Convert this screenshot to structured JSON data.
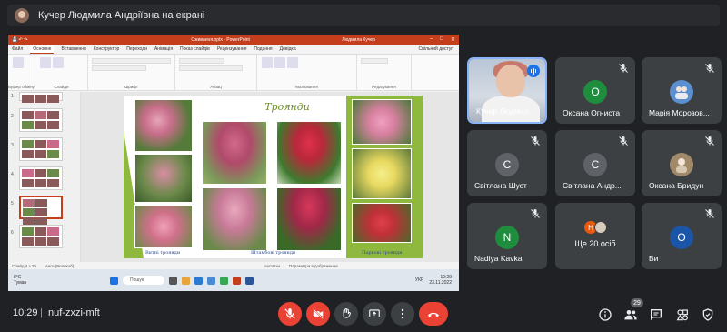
{
  "banner": {
    "text": "Кучер Людмила Андріївна на екрані"
  },
  "presentation": {
    "app_title": "Оживання.pptx  -  PowerPoint",
    "user_name": "Людмила Кучер",
    "tabs": [
      "Файл",
      "Основне",
      "Вставлення",
      "Конструктор",
      "Переходи",
      "Анімація",
      "Показ слайдів",
      "Рецензування",
      "Подання",
      "Довідка"
    ],
    "active_tab": "Основне",
    "share_label": "Спільний доступ",
    "ribbon_groups": [
      "Буфер обміну",
      "Слайди",
      "Шрифт",
      "Абзац",
      "Малювання",
      "Редагування"
    ],
    "slide_numbers": [
      "1",
      "2",
      "3",
      "4",
      "5",
      "6"
    ],
    "slide_title": "Троянди",
    "captions": [
      "Витні троянди",
      "Штамбові троянди",
      "Паркові троянди"
    ],
    "status_left": "Слайд 4 з 29",
    "status_lang": "Англ (Великоб)",
    "status_notes": "Нотатки",
    "status_display": "Параметри відображення",
    "weather_temp": "8°C",
    "weather_desc": "Туман",
    "taskbar_search": "Пошук",
    "tray_lang": "УКР",
    "tray_time": "10:29",
    "tray_date": "23.11.2022"
  },
  "participants": [
    {
      "name": "Кучер Людмил...",
      "initial": "",
      "color": "",
      "active": true
    },
    {
      "name": "Оксана Огниста",
      "initial": "О",
      "color": "#1e8e3e"
    },
    {
      "name": "Марія Морозов...",
      "initial": "",
      "color": "#5b8fcf"
    },
    {
      "name": "Світлана Шуст",
      "initial": "С",
      "color": "#5f6368"
    },
    {
      "name": "Світлана Андр...",
      "initial": "С",
      "color": "#5f6368"
    },
    {
      "name": "Оксана Бридун",
      "initial": "",
      "color": "#a08a6a"
    },
    {
      "name": "Nadiya Kavka",
      "initial": "N",
      "color": "#1e8e3e"
    },
    {
      "name": "Ще 20 осіб",
      "initial": "Н",
      "color": "#e8590c"
    },
    {
      "name": "Ви",
      "initial": "О",
      "color": "#1a55a8"
    }
  ],
  "bottom": {
    "time": "10:29",
    "separator": "|",
    "meeting_code": "nuf-zxzi-mft",
    "people_count": "29"
  },
  "colors": {
    "end_call": "#ea4335",
    "accent_blue": "#8ab4f8",
    "slide_green": "#8fb93e"
  }
}
